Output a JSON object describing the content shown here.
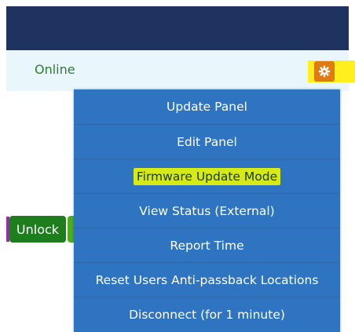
{
  "status": {
    "text": "Online"
  },
  "gear": {
    "icon": "gear-icon",
    "color": "#e07a12",
    "highlight_color": "#ffef1f"
  },
  "unlock": {
    "label": "Unlock"
  },
  "menu": {
    "items": [
      {
        "label": "Update Panel",
        "highlighted": false
      },
      {
        "label": "Edit Panel",
        "highlighted": false
      },
      {
        "label": "Firmware Update Mode",
        "highlighted": true
      },
      {
        "label": "View Status (External)",
        "highlighted": false
      },
      {
        "label": "Report Time",
        "highlighted": false
      },
      {
        "label": "Reset Users Anti-passback Locations",
        "highlighted": false
      },
      {
        "label": "Disconnect (for 1 minute)",
        "highlighted": false
      }
    ]
  },
  "colors": {
    "header": "#1e3360",
    "row_background": "#e9f6fb",
    "menu_background": "#2f74c0",
    "status_text": "#2e7d32",
    "unlock_button": "#1e7e1e",
    "menu_item_highlight": "#d6ea18"
  }
}
